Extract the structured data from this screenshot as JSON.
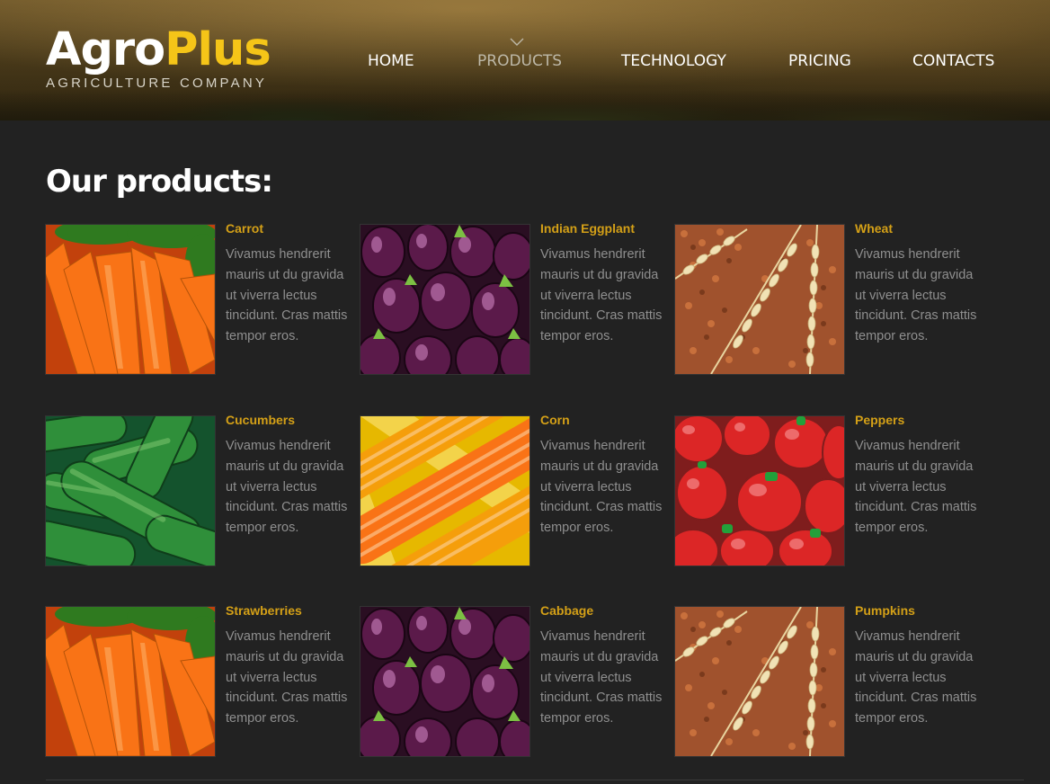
{
  "brand": {
    "name_part1": "Agro",
    "name_part2": "Plus",
    "tagline": "AGRICULTURE COMPANY"
  },
  "nav": {
    "items": [
      {
        "label": "HOME",
        "active": false
      },
      {
        "label": "PRODUCTS",
        "active": true
      },
      {
        "label": "TECHNOLOGY",
        "active": false
      },
      {
        "label": "PRICING",
        "active": false
      },
      {
        "label": "CONTACTS",
        "active": false
      }
    ]
  },
  "main": {
    "title": "Our products:",
    "products": [
      {
        "name": "Carrot",
        "image": "carrots-image",
        "description": "Vivamus hendrerit mauris ut du gravida ut viverra lectus tincidunt. Cras mattis tempor eros."
      },
      {
        "name": "Indian Eggplant",
        "image": "eggplant-image",
        "description": "Vivamus hendrerit mauris ut du gravida ut viverra lectus tincidunt. Cras mattis tempor eros."
      },
      {
        "name": "Wheat",
        "image": "wheat-image",
        "description": "Vivamus hendrerit mauris ut du gravida ut viverra lectus tincidunt. Cras mattis tempor eros."
      },
      {
        "name": "Cucumbers",
        "image": "cucumbers-image",
        "description": "Vivamus hendrerit mauris ut du gravida ut viverra lectus tincidunt. Cras mattis tempor eros."
      },
      {
        "name": "Corn",
        "image": "corn-image",
        "description": "Vivamus hendrerit mauris ut du gravida ut viverra lectus tincidunt. Cras mattis tempor eros."
      },
      {
        "name": "Peppers",
        "image": "peppers-image",
        "description": "Vivamus hendrerit mauris ut du gravida ut viverra lectus tincidunt. Cras mattis tempor eros."
      },
      {
        "name": "Strawberries",
        "image": "carrots-image",
        "description": "Vivamus hendrerit mauris ut du gravida ut viverra lectus tincidunt. Cras mattis tempor eros."
      },
      {
        "name": "Cabbage",
        "image": "eggplant-image",
        "description": "Vivamus hendrerit mauris ut du gravida ut viverra lectus tincidunt. Cras mattis tempor eros."
      },
      {
        "name": "Pumpkins",
        "image": "wheat-image",
        "description": "Vivamus hendrerit mauris ut du gravida ut viverra lectus tincidunt. Cras mattis tempor eros."
      }
    ]
  },
  "colors": {
    "accent_yellow": "#f5c518",
    "product_name": "#d4a017",
    "body_bg": "#222222",
    "desc_text": "#8f8f8f"
  }
}
